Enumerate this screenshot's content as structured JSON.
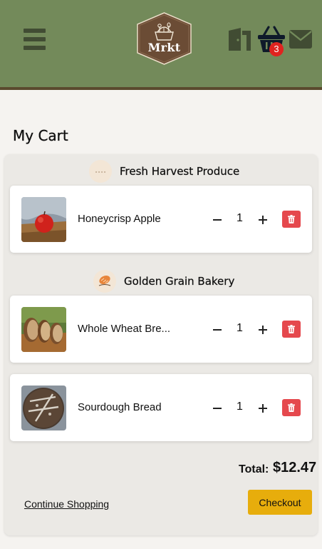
{
  "header": {
    "logo_text": "Mrkt",
    "cart_count": "3",
    "colors": {
      "header_bg": "#738a5a",
      "icon": "#414c33",
      "border": "#5a4a2e",
      "badge": "#e0231f"
    },
    "icons": [
      "menu-icon",
      "door-icon",
      "basket-icon",
      "mail-icon"
    ]
  },
  "page": {
    "title": "My Cart"
  },
  "vendors": [
    {
      "name": "Fresh Harvest Produce",
      "items": [
        {
          "name": "Honeycrisp Apple",
          "quantity": "1"
        }
      ]
    },
    {
      "name": "Golden Grain Bakery",
      "items": [
        {
          "name": "Whole Wheat Bre...",
          "quantity": "1"
        },
        {
          "name": "Sourdough Bread",
          "quantity": "1"
        }
      ]
    }
  ],
  "summary": {
    "total_label": "Total:",
    "total_value": "$12.47",
    "continue_label": "Continue Shopping",
    "checkout_label": "Checkout",
    "checkout_color": "#e7ad0c",
    "delete_color": "#e5484d"
  }
}
